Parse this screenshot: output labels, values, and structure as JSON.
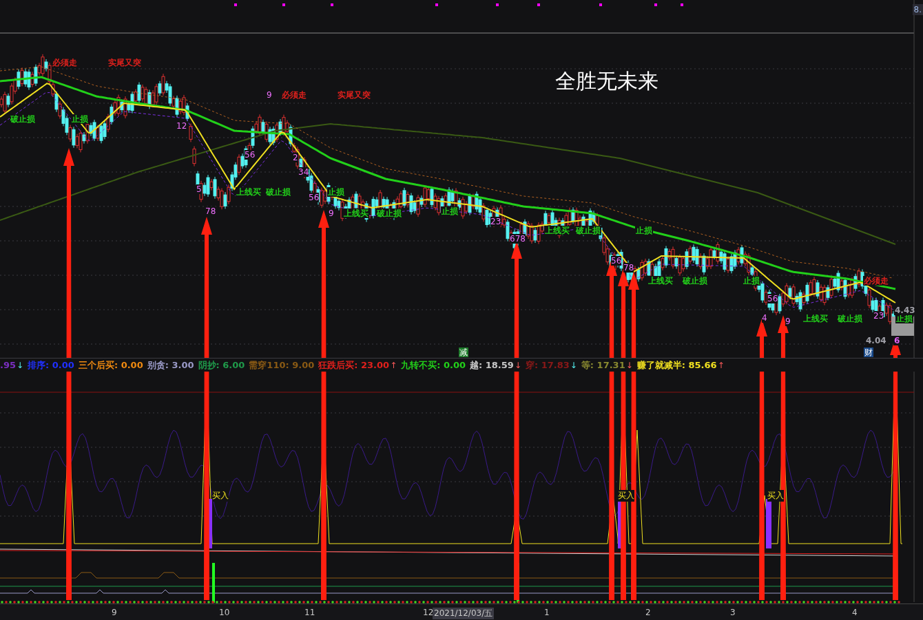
{
  "title": "全胜无未来",
  "price_axis_label": "8.",
  "chart_labels": [
    {
      "text": "必须走",
      "color": "#e0201c"
    },
    {
      "text": "实尾又突",
      "color": "#e0201c"
    },
    {
      "text": "破止损",
      "color": "#22d01a"
    },
    {
      "text": "止损",
      "color": "#22d01a"
    },
    {
      "text": "必须走",
      "color": "#e0201c"
    },
    {
      "text": "实尾又突",
      "color": "#e0201c"
    },
    {
      "text": "上线买",
      "color": "#22d01a"
    },
    {
      "text": "破止损",
      "color": "#22d01a"
    },
    {
      "text": "止损",
      "color": "#22d01a"
    },
    {
      "text": "上线买",
      "color": "#22d01a"
    },
    {
      "text": "破止损",
      "color": "#22d01a"
    },
    {
      "text": "止损",
      "color": "#22d01a"
    },
    {
      "text": "上线买",
      "color": "#22d01a"
    },
    {
      "text": "破止损",
      "color": "#22d01a"
    },
    {
      "text": "止损",
      "color": "#22d01a"
    },
    {
      "text": "上线买",
      "color": "#22d01a"
    },
    {
      "text": "破止损",
      "color": "#22d01a"
    },
    {
      "text": "止损",
      "color": "#22d01a"
    },
    {
      "text": "上线买",
      "color": "#22d01a"
    },
    {
      "text": "破止损",
      "color": "#22d01a"
    },
    {
      "text": "止损",
      "color": "#22d01a"
    },
    {
      "text": "必须走",
      "color": "#e0201c"
    },
    {
      "text": "4.43",
      "color": "#a0a0a8"
    },
    {
      "text": "4.04",
      "color": "#a0a0a8"
    },
    {
      "text": "6",
      "color": "#e060f0"
    }
  ],
  "counts": [
    "9",
    "12",
    "5",
    "78",
    "56",
    "2",
    "34",
    "56",
    "9",
    "23",
    "678",
    "56",
    "78",
    "4",
    "56",
    "9",
    "23"
  ],
  "badges": [
    {
      "text": "减",
      "color": "#1d7a2a"
    },
    {
      "text": "财",
      "color": "#1a4a8a"
    }
  ],
  "indicators": [
    {
      "text": ".95",
      "color": "#7a2fc0",
      "arrow": "↓"
    },
    {
      "text": "排序: 0.00",
      "color": "#2030ff"
    },
    {
      "text": "三个后买: 0.00",
      "color": "#f08a10"
    },
    {
      "text": "别贪: 3.00",
      "color": "#9a9ac8"
    },
    {
      "text": "阴抄: 6.00",
      "color": "#1f9a4a"
    },
    {
      "text": "需穿110: 9.00",
      "color": "#8a5a14"
    },
    {
      "text": "狂跌后买: 23.00",
      "color": "#e0201c",
      "arrow": "↑"
    },
    {
      "text": "九转不买: 0.00",
      "color": "#22d01a"
    },
    {
      "text": "越: 18.59",
      "color": "#c8c8c8",
      "arrow": "↓"
    },
    {
      "text": "穿: 17.83",
      "color": "#8a1818",
      "arrow": "↓"
    },
    {
      "text": "等: 17.31",
      "color": "#8a8a30",
      "arrow": "↓"
    },
    {
      "text": "赚了就减半: 85.66",
      "color": "#f0e020",
      "arrow": "↑"
    }
  ],
  "buy_labels": [
    "买入",
    "买入",
    "买入"
  ],
  "x_axis": [
    {
      "text": "9",
      "kind": "tick"
    },
    {
      "text": "10",
      "kind": "tick"
    },
    {
      "text": "11",
      "kind": "tick"
    },
    {
      "text": "12",
      "kind": "tick"
    },
    {
      "text": "2021/12/03/五",
      "kind": "cursor"
    },
    {
      "text": "1",
      "kind": "tick"
    },
    {
      "text": "2",
      "kind": "tick"
    },
    {
      "text": "3",
      "kind": "tick"
    },
    {
      "text": "4",
      "kind": "tick"
    }
  ]
}
